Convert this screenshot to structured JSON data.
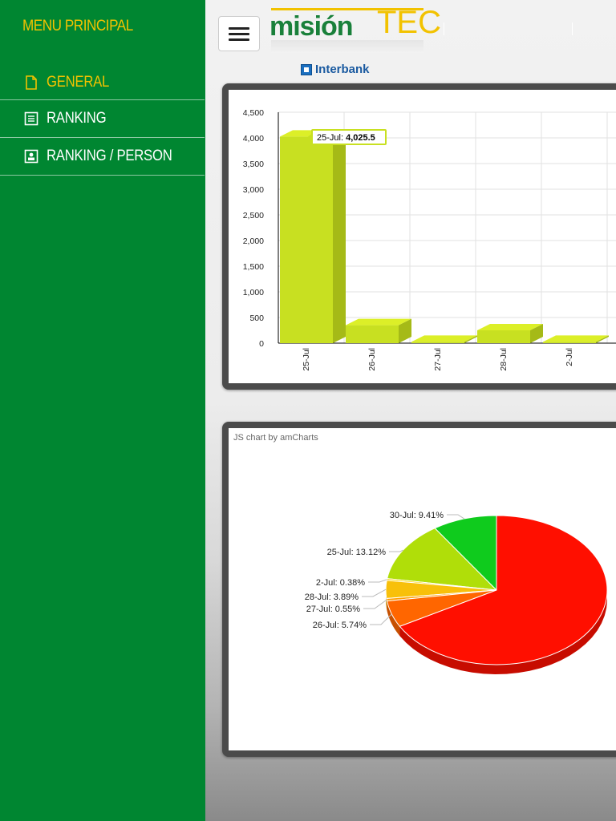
{
  "sidebar": {
    "title": "MENU PRINCIPAL",
    "items": [
      {
        "label": "GENERAL",
        "icon": "file-icon",
        "active": true
      },
      {
        "label": "RANKING",
        "icon": "list-icon",
        "active": false
      },
      {
        "label": "RANKING /  PERSON",
        "icon": "contact-card-icon",
        "active": false
      }
    ]
  },
  "header": {
    "logo_text_main": "misión",
    "logo_text_accent": "TEC",
    "sponsor": "Interbank"
  },
  "colors": {
    "sidebar_bg": "#008631",
    "accent_yellow": "#f2c200",
    "bar_color": "#c8e021"
  },
  "chart_data": [
    {
      "type": "bar",
      "categories": [
        "25-Jul",
        "26-Jul",
        "27-Jul",
        "28-Jul",
        "2-Jul"
      ],
      "values": [
        4025.5,
        350,
        25,
        250,
        25
      ],
      "ylim": [
        0,
        4500
      ],
      "yticks": [
        "0",
        "500",
        "1,000",
        "1,500",
        "2,000",
        "2,500",
        "3,000",
        "3,500",
        "4,000",
        "4,500"
      ],
      "tooltip": {
        "label": "25-Jul:",
        "value": "4,025.5"
      },
      "grid": true
    },
    {
      "type": "pie",
      "credit": "JS chart by amCharts",
      "slices": [
        {
          "label": "30-Jul: 9.41%",
          "value": 9.41,
          "color": "#0fcb1d"
        },
        {
          "label": "25-Jul: 13.12%",
          "value": 13.12,
          "color": "#b0de09"
        },
        {
          "label": "2-Jul: 0.38%",
          "value": 0.38,
          "color": "#fcd202"
        },
        {
          "label": "28-Jul: 3.89%",
          "value": 3.89,
          "color": "#f8c00a"
        },
        {
          "label": "27-Jul: 0.55%",
          "value": 0.55,
          "color": "#ff9e01"
        },
        {
          "label": "26-Jul: 5.74%",
          "value": 5.74,
          "color": "#ff6600"
        },
        {
          "label": "",
          "value": 66.91,
          "color": "#ff0f00"
        }
      ]
    }
  ]
}
